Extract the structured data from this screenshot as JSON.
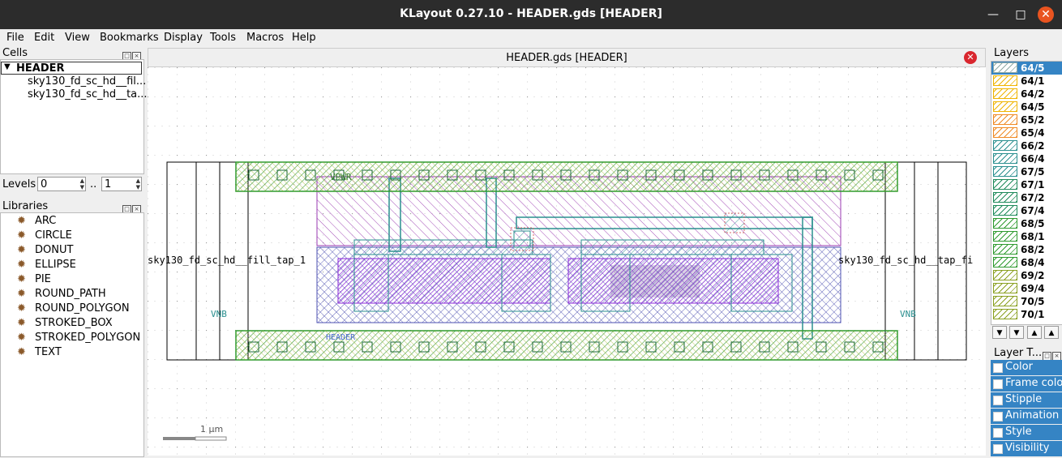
{
  "window": {
    "title": "KLayout 0.27.10 - HEADER.gds [HEADER]"
  },
  "menu": [
    "File",
    "Edit",
    "View",
    "Bookmarks",
    "Display",
    "Tools",
    "Macros",
    "Help"
  ],
  "cells": {
    "title": "Cells",
    "top": "HEADER",
    "children": [
      "sky130_fd_sc_hd__fil...",
      "sky130_fd_sc_hd__ta..."
    ]
  },
  "levels": {
    "label": "Levels",
    "from": "0",
    "sep": "..",
    "to": "1"
  },
  "libraries": {
    "title": "Libraries",
    "items": [
      "ARC",
      "CIRCLE",
      "DONUT",
      "ELLIPSE",
      "PIE",
      "ROUND_PATH",
      "ROUND_POLYGON",
      "STROKED_BOX",
      "STROKED_POLYGON",
      "TEXT"
    ]
  },
  "view": {
    "tab_title": "HEADER.gds [HEADER]",
    "labels": {
      "vpwr": "VPWR",
      "vnb_left": "VNB",
      "vnb_right": "VNB",
      "header": "HEADER",
      "left_cell": "sky130_fd_sc_hd__fill_tap_1",
      "right_cell": "sky130_fd_sc_hd__tap_fi"
    },
    "scale_label": "1 µm"
  },
  "layers": {
    "title": "Layers",
    "items": [
      {
        "name": "64/5",
        "color": "#8fa9a4"
      },
      {
        "name": "64/1",
        "color": "#f0b400"
      },
      {
        "name": "64/2",
        "color": "#f0b400"
      },
      {
        "name": "64/5",
        "color": "#f0b400"
      },
      {
        "name": "65/2",
        "color": "#f08a24"
      },
      {
        "name": "65/4",
        "color": "#f08a24"
      },
      {
        "name": "66/2",
        "color": "#2a8f8f"
      },
      {
        "name": "66/4",
        "color": "#2a8f8f"
      },
      {
        "name": "67/5",
        "color": "#2a8f8f"
      },
      {
        "name": "67/1",
        "color": "#1e8a5a"
      },
      {
        "name": "67/2",
        "color": "#1e8a5a"
      },
      {
        "name": "67/4",
        "color": "#1e8a5a"
      },
      {
        "name": "68/5",
        "color": "#2e9a2e"
      },
      {
        "name": "68/1",
        "color": "#2e9a2e"
      },
      {
        "name": "68/2",
        "color": "#2e9a2e"
      },
      {
        "name": "68/4",
        "color": "#2e9a2e"
      },
      {
        "name": "69/2",
        "color": "#8aa020"
      },
      {
        "name": "69/4",
        "color": "#8aa020"
      },
      {
        "name": "70/5",
        "color": "#8aa020"
      },
      {
        "name": "70/1",
        "color": "#8aa020"
      }
    ]
  },
  "toolbox": {
    "title": "Layer T...",
    "items": [
      "Color",
      "Frame color",
      "Stipple",
      "Animation",
      "Style",
      "Visibility"
    ]
  }
}
